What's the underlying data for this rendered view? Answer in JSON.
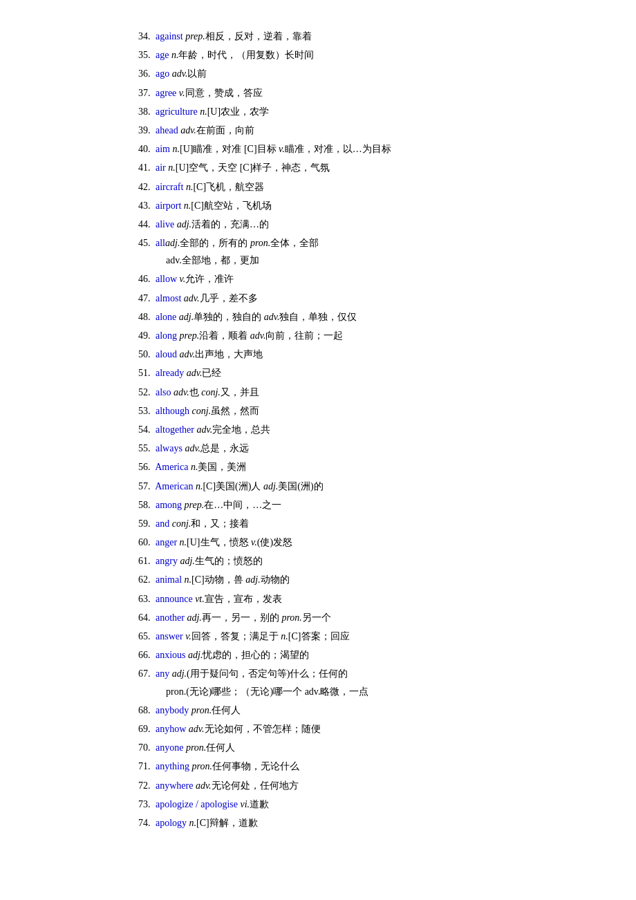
{
  "entries": [
    {
      "number": "34.",
      "word": "against",
      "pos": "prep.",
      "definition": "相反，反对，逆着，靠着"
    },
    {
      "number": "35.",
      "word": "age",
      "pos": "n.",
      "definition": "年龄，时代，（用复数）长时间"
    },
    {
      "number": "36.",
      "word": "ago",
      "pos": "adv.",
      "definition": "以前"
    },
    {
      "number": "37.",
      "word": "agree",
      "pos": "v.",
      "definition": "同意，赞成，答应"
    },
    {
      "number": "38.",
      "word": "agriculture",
      "pos": "n.",
      "definition": "[U]农业，农学"
    },
    {
      "number": "39.",
      "word": "ahead",
      "pos": "adv.",
      "definition": "在前面，向前"
    },
    {
      "number": "40.",
      "word": "aim",
      "pos1": "n.",
      "def1": "[U]瞄准，对准 [C]目标",
      "pos2": "v.",
      "def2": "瞄准，对准，以…为目标",
      "multipos": true
    },
    {
      "number": "41.",
      "word": "air",
      "pos": "n.",
      "definition": "[U]空气，天空 [C]样子，神态，气氛"
    },
    {
      "number": "42.",
      "word": "aircraft",
      "pos": "n.",
      "definition": "[C]飞机，航空器"
    },
    {
      "number": "43.",
      "word": "airport",
      "pos": "n.",
      "definition": "[C]航空站，飞机场"
    },
    {
      "number": "44.",
      "word": "alive",
      "pos": "adj.",
      "definition": "活着的，充满…的"
    },
    {
      "number": "45.",
      "word": "all",
      "pos1": "adj.",
      "def1": "全部的，所有的",
      "pos2": "pron.",
      "def2": "全体，全部",
      "continuation": "adv.全部地，都，更加",
      "multipos": true
    },
    {
      "number": "46.",
      "word": "allow",
      "pos": "v.",
      "definition": "允许，准许"
    },
    {
      "number": "47.",
      "word": "almost",
      "pos": "adv.",
      "definition": "几乎，差不多"
    },
    {
      "number": "48.",
      "word": "alone",
      "pos1": "adj.",
      "def1": "单独的，独自的",
      "pos2": "adv.",
      "def2": "独自，单独，仅仅",
      "multipos": true
    },
    {
      "number": "49.",
      "word": "along",
      "pos1": "prep.",
      "def1": "沿着，顺着",
      "pos2": "adv.",
      "def2": "向前，往前；一起",
      "multipos": true
    },
    {
      "number": "50.",
      "word": "aloud",
      "pos": "adv.",
      "definition": "出声地，大声地"
    },
    {
      "number": "51.",
      "word": "already",
      "pos": "adv.",
      "definition": "已经"
    },
    {
      "number": "52.",
      "word": "also",
      "pos1": "adv.",
      "def1": "也",
      "pos2": "conj.",
      "def2": "又，并且",
      "multipos": true
    },
    {
      "number": "53.",
      "word": "although",
      "pos": "conj.",
      "definition": "虽然，然而"
    },
    {
      "number": "54.",
      "word": "altogether",
      "pos": "adv.",
      "definition": "完全地，总共"
    },
    {
      "number": "55.",
      "word": "always",
      "pos": "adv.",
      "definition": "总是，永远"
    },
    {
      "number": "56.",
      "word": "America",
      "pos": "n.",
      "definition": "美国，美洲"
    },
    {
      "number": "57.",
      "word": "American",
      "pos1": "n.",
      "def1": "[C]美国(洲)人",
      "pos2": "adj.",
      "def2": "美国(洲)的",
      "multipos": true
    },
    {
      "number": "58.",
      "word": "among",
      "pos": "prep.",
      "definition": "在…中间，…之一"
    },
    {
      "number": "59.",
      "word": "and",
      "pos": "conj.",
      "definition": "和，又；接着"
    },
    {
      "number": "60.",
      "word": "anger",
      "pos1": "n.",
      "def1": "[U]生气，愤怒",
      "pos2": "v.",
      "def2": "(使)发怒",
      "multipos": true
    },
    {
      "number": "61.",
      "word": "angry",
      "pos": "adj.",
      "definition": "生气的；愤怒的"
    },
    {
      "number": "62.",
      "word": "animal",
      "pos1": "n.",
      "def1": "[C]动物，兽",
      "pos2": "adj.",
      "def2": "动物的",
      "multipos": true
    },
    {
      "number": "63.",
      "word": "announce",
      "pos": "vt.",
      "definition": "宣告，宣布，发表"
    },
    {
      "number": "64.",
      "word": "another",
      "pos1": "adj.",
      "def1": "再一，另一，别的",
      "pos2": "pron.",
      "def2": "另一个",
      "multipos": true
    },
    {
      "number": "65.",
      "word": "answer",
      "pos1": "v.",
      "def1": "回答，答复；满足于",
      "pos2": "n.",
      "def2": "[C]答案；回应",
      "multipos": true
    },
    {
      "number": "66.",
      "word": "anxious",
      "pos": "adj.",
      "definition": "忧虑的，担心的；渴望的"
    },
    {
      "number": "67.",
      "word": "any",
      "pos1": "adj.",
      "def1": "(用于疑问句，否定句等)什么；任何的",
      "continuation": "pron.(无论)哪些；（无论)哪一个  adv.略微，一点",
      "multipos": false
    },
    {
      "number": "68.",
      "word": "anybody",
      "pos": "pron.",
      "definition": "任何人"
    },
    {
      "number": "69.",
      "word": "anyhow",
      "pos": "adv.",
      "definition": "无论如何，不管怎样；随便"
    },
    {
      "number": "70.",
      "word": "anyone",
      "pos": "pron.",
      "definition": "任何人"
    },
    {
      "number": "71.",
      "word": "anything",
      "pos": "pron.",
      "definition": "任何事物，无论什么"
    },
    {
      "number": "72.",
      "word": "anywhere",
      "pos": "adv.",
      "definition": "无论何处，任何地方"
    },
    {
      "number": "73.",
      "word": "apologize / apologise",
      "pos": "vi.",
      "definition": "道歉"
    },
    {
      "number": "74.",
      "word": "apology",
      "pos": "n.",
      "definition": "[C]辩解，道歉"
    }
  ]
}
